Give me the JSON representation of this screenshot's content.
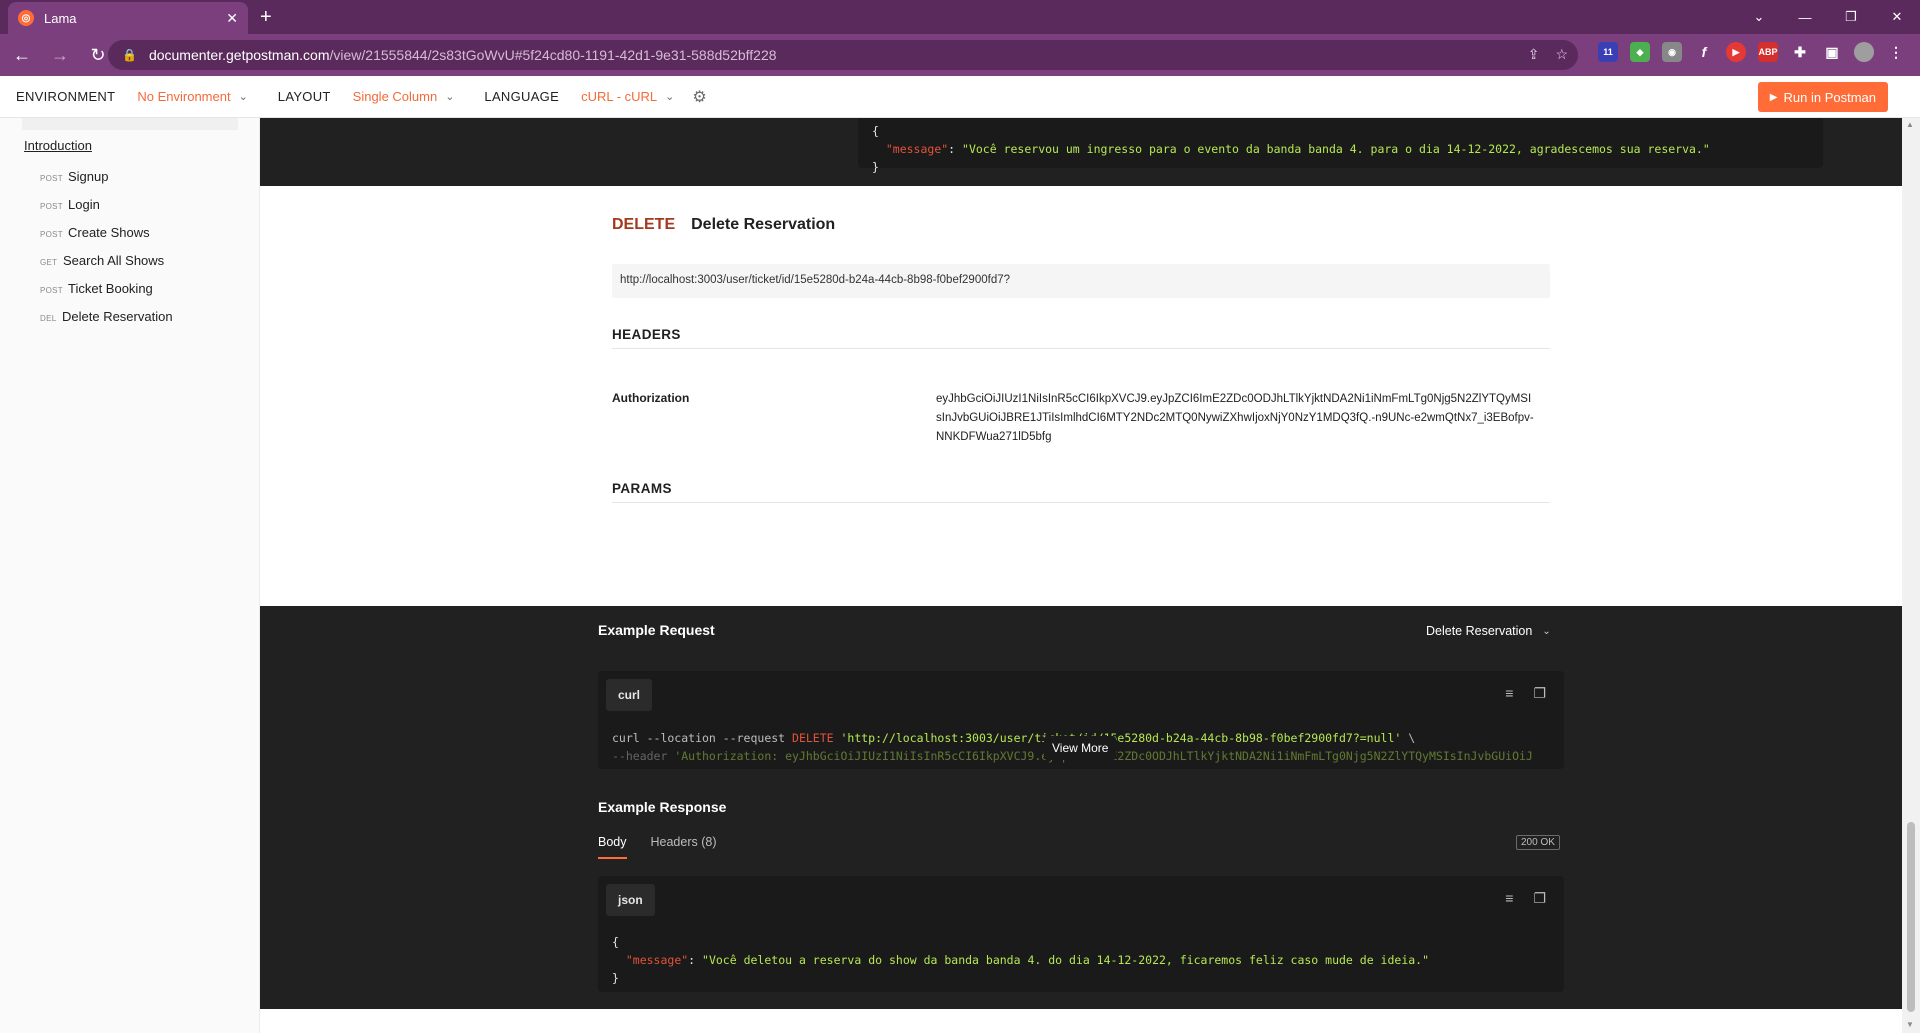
{
  "browser": {
    "tab_title": "Lama",
    "url_host": "documenter.getpostman.com",
    "url_path": "/view/21555844/2s83tGoWvU#5f24cd80-1191-42d1-9e31-588d52bff228"
  },
  "docbar": {
    "environment_label": "ENVIRONMENT",
    "environment_value": "No Environment",
    "layout_label": "LAYOUT",
    "layout_value": "Single Column",
    "language_label": "LANGUAGE",
    "language_value": "cURL - cURL",
    "run_button": "Run in Postman"
  },
  "sidebar": {
    "intro": "Introduction",
    "items": [
      {
        "method": "POST",
        "label": "Signup"
      },
      {
        "method": "POST",
        "label": "Login"
      },
      {
        "method": "POST",
        "label": "Create Shows"
      },
      {
        "method": "GET",
        "label": "Search All Shows"
      },
      {
        "method": "POST",
        "label": "Ticket Booking"
      },
      {
        "method": "DEL",
        "label": "Delete Reservation"
      }
    ]
  },
  "prev_response": {
    "open": "{",
    "key": "\"message\"",
    "value": "\"Você reservou um ingresso para o evento da banda banda 4. para o dia 14-12-2022, agradescemos sua reserva.\"",
    "close": "}"
  },
  "endpoint": {
    "method": "DELETE",
    "name": "Delete Reservation",
    "url": "http://localhost:3003/user/ticket/id/15e5280d-b24a-44cb-8b98-f0bef2900fd7?",
    "headers_title": "HEADERS",
    "params_title": "PARAMS",
    "header_key": "Authorization",
    "header_value": "eyJhbGciOiJIUzI1NiIsInR5cCI6IkpXVCJ9.eyJpZCI6ImE2ZDc0ODJhLTlkYjktNDA2Ni1iNmFmLTg0Njg5N2ZlYTQyMSIsInJvbGUiOiJBRE1JTiIsImlhdCI6MTY2NDc2MTQ0NywiZXhwIjoxNjY0NzY1MDQ3fQ.-n9UNc-e2wmQtNx7_i3EBofpv-NNKDFWua271lD5bfg"
  },
  "example_request": {
    "title": "Example Request",
    "selected": "Delete Reservation",
    "lang": "curl",
    "line1_a": "curl --location --request ",
    "line1_method": "DELETE",
    "line1_url": " 'http://localhost:3003/user/ticket/id/15e5280d-b24a-44cb-8b98-f0bef2900fd7?=null'",
    "line1_end": " \\",
    "line2_a": "--header ",
    "line2_val": "'Authorization: eyJhbGciOiJIUzI1NiIsInR5cCI6IkpXVCJ9.eyJpZCI6ImE2ZDc0ODJhLTlkYjktNDA2Ni1iNmFmLTg0Njg5N2ZlYTQyMSIsInJvbGUiOiJ",
    "view_more": "View More"
  },
  "example_response": {
    "title": "Example Response",
    "tab_body": "Body",
    "tab_headers": "Headers (8)",
    "status": "200 OK",
    "lang": "json",
    "open": "{",
    "key": "\"message\"",
    "value": "\"Você deletou a reserva do show da banda banda 4. do dia 14-12-2022, ficaremos feliz caso mude de ideia.\"",
    "close": "}"
  },
  "colors": {
    "accent": "#ff6c37",
    "delete_method": "#a33a1f",
    "json_key": "#e2533a",
    "json_string": "#b5e853",
    "browser_frame": "#7b3f7e"
  }
}
